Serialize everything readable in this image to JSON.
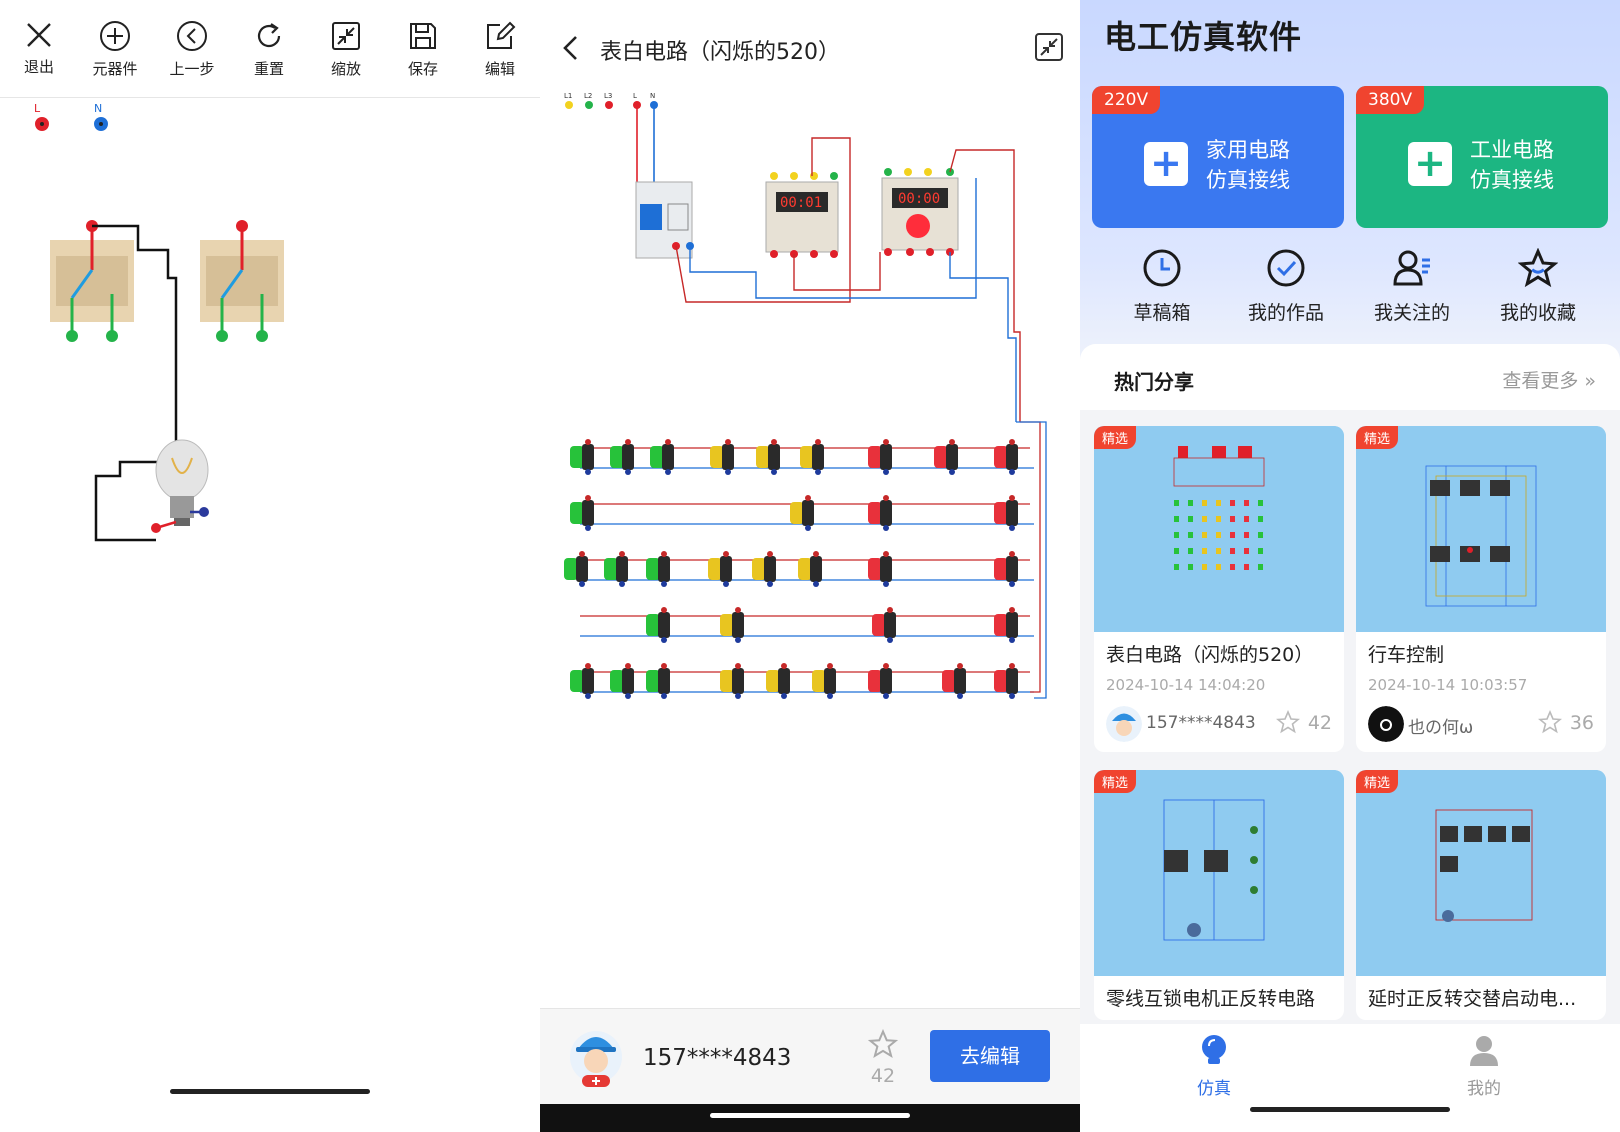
{
  "editor": {
    "toolbar": [
      {
        "label": "退出",
        "icon": "close-icon"
      },
      {
        "label": "元器件",
        "icon": "plus-circle-icon"
      },
      {
        "label": "上一步",
        "icon": "back-circle-icon"
      },
      {
        "label": "重置",
        "icon": "reset-icon"
      },
      {
        "label": "缩放",
        "icon": "zoom-icon"
      },
      {
        "label": "保存",
        "icon": "save-icon"
      },
      {
        "label": "编辑",
        "icon": "edit-icon"
      }
    ],
    "terminals": {
      "live": "L",
      "neutral": "N"
    }
  },
  "preview": {
    "title": "表白电路（闪烁的520）",
    "terminal_labels": [
      "L1",
      "L2",
      "L3",
      "L",
      "N"
    ],
    "timer_left": "00:01",
    "timer_right": "00:00",
    "author": "157****4843",
    "likes": "42",
    "edit_button": "去编辑"
  },
  "home": {
    "app_title": "电工仿真软件",
    "cards": [
      {
        "tag": "220V",
        "line1": "家用电路",
        "line2": "仿真接线",
        "color": "#3a78f0"
      },
      {
        "tag": "380V",
        "line1": "工业电路",
        "line2": "仿真接线",
        "color": "#1cb682"
      }
    ],
    "quick": [
      {
        "label": "草稿箱",
        "icon": "clock-icon"
      },
      {
        "label": "我的作品",
        "icon": "check-circle-icon"
      },
      {
        "label": "我关注的",
        "icon": "user-follow-icon"
      },
      {
        "label": "我的收藏",
        "icon": "star-icon"
      }
    ],
    "hot_title": "热门分享",
    "more": "查看更多 »",
    "shares": [
      {
        "badge": "精选",
        "title": "表白电路（闪烁的520）",
        "date": "2024-10-14 14:04:20",
        "user": "157****4843",
        "likes": "42"
      },
      {
        "badge": "精选",
        "title": "行车控制",
        "date": "2024-10-14 10:03:57",
        "user": "也の何ω",
        "likes": "36"
      },
      {
        "badge": "精选",
        "title": "零线互锁电机正反转电路"
      },
      {
        "badge": "精选",
        "title": "延时正反转交替启动电..."
      }
    ],
    "nav": [
      {
        "label": "仿真",
        "icon": "bulb-icon",
        "active": true
      },
      {
        "label": "我的",
        "icon": "person-icon",
        "active": false
      }
    ],
    "accent": "#2f6fe6"
  }
}
